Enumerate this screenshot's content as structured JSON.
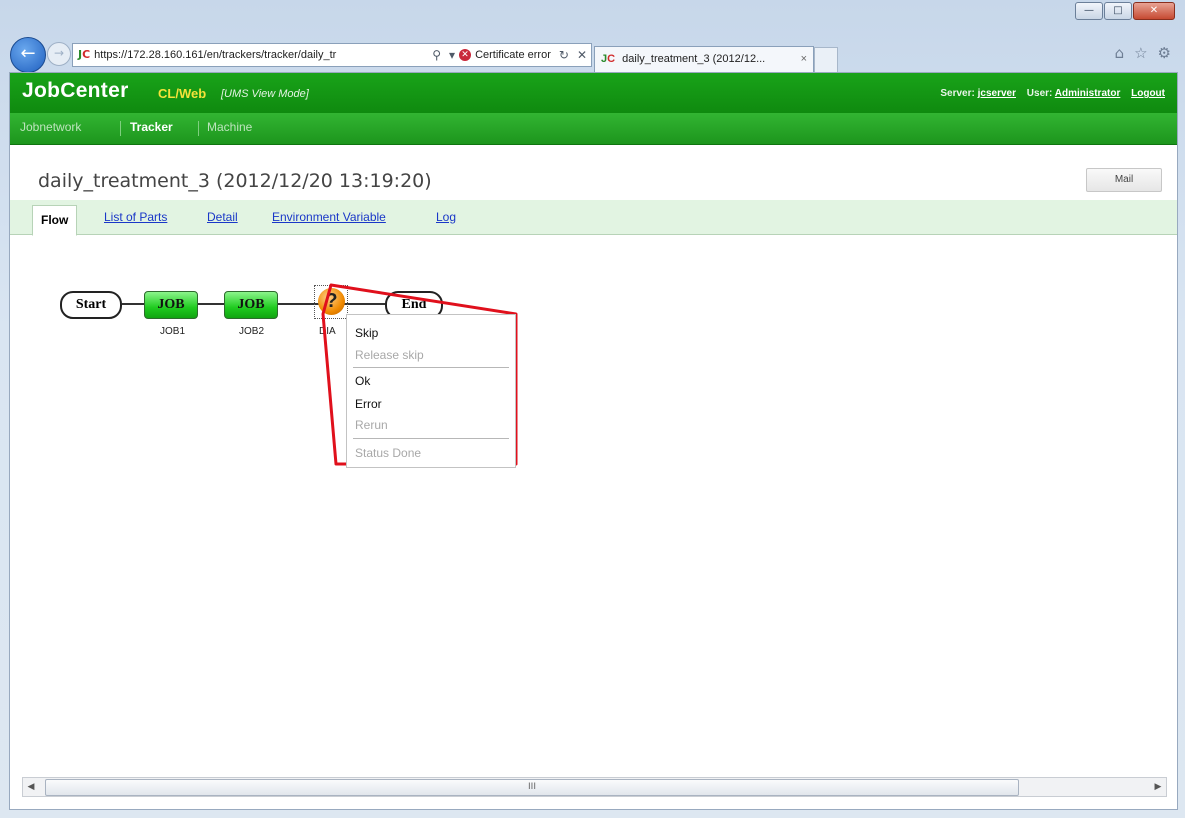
{
  "browser": {
    "url": "https://172.28.160.161/en/trackers/tracker/daily_tr",
    "cert_error": "Certificate error",
    "tab_title": "daily_treatment_3 (2012/12...",
    "brand_mark": "JC"
  },
  "app": {
    "brand": "JobCenter",
    "edition": "CL/Web",
    "mode": "[UMS View Mode]",
    "server_label": "Server:",
    "server": "jcserver",
    "user_label": "User:",
    "user": "Administrator",
    "logout": "Logout"
  },
  "nav": [
    "Jobnetwork",
    "Tracker",
    "Machine"
  ],
  "page": {
    "title": "daily_treatment_3 (2012/12/20 13:19:20)",
    "mail_button": "Mail"
  },
  "subtabs": [
    "Flow",
    "List of Parts",
    "Detail",
    "Environment Variable",
    "Log"
  ],
  "flow": {
    "start": "Start",
    "end": "End",
    "jobs": [
      {
        "type": "JOB",
        "name": "JOB1"
      },
      {
        "type": "JOB",
        "name": "JOB2"
      }
    ],
    "dialog_icon": "?",
    "dialog_name": "DIA"
  },
  "context_menu": {
    "items": [
      {
        "label": "Skip",
        "enabled": true
      },
      {
        "label": "Release skip",
        "enabled": false
      },
      {
        "label": "Ok",
        "enabled": true
      },
      {
        "label": "Error",
        "enabled": true
      },
      {
        "label": "Rerun",
        "enabled": false
      },
      {
        "label": "Status Done",
        "enabled": false
      }
    ],
    "highlight_color": "#e0101c"
  },
  "scrollbar": {
    "thumb_grip": "III"
  }
}
